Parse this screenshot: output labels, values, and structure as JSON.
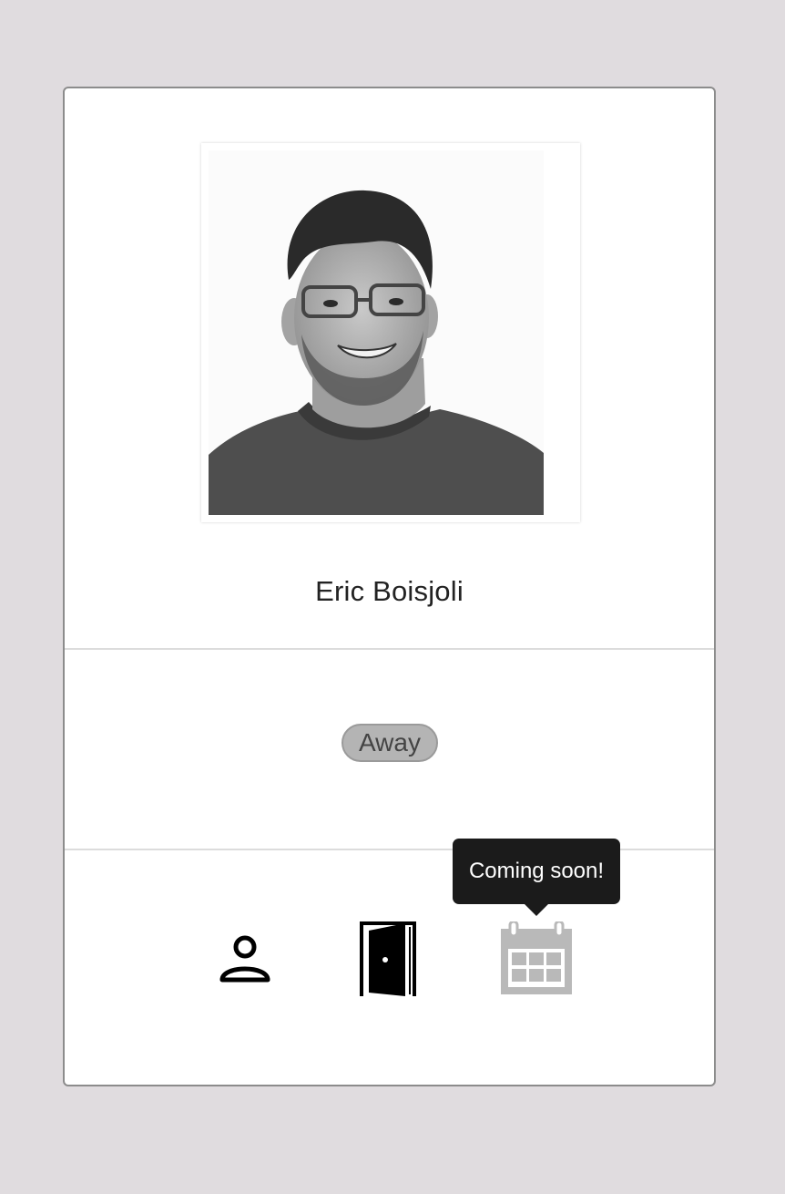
{
  "profile": {
    "name": "Eric Boisjoli",
    "photo_icon": "user-photo"
  },
  "status": {
    "label": "Away",
    "color": "#b4b4b4"
  },
  "actions": [
    {
      "icon": "person-icon",
      "enabled": true
    },
    {
      "icon": "door-exit-icon",
      "enabled": true
    },
    {
      "icon": "calendar-icon",
      "enabled": false
    }
  ],
  "tooltip": {
    "text": "Coming soon!"
  },
  "colors": {
    "background": "#e0dcdf",
    "card": "#ffffff",
    "tooltip": "#1b1b1b",
    "disabled_icon": "#b9b9b9"
  }
}
